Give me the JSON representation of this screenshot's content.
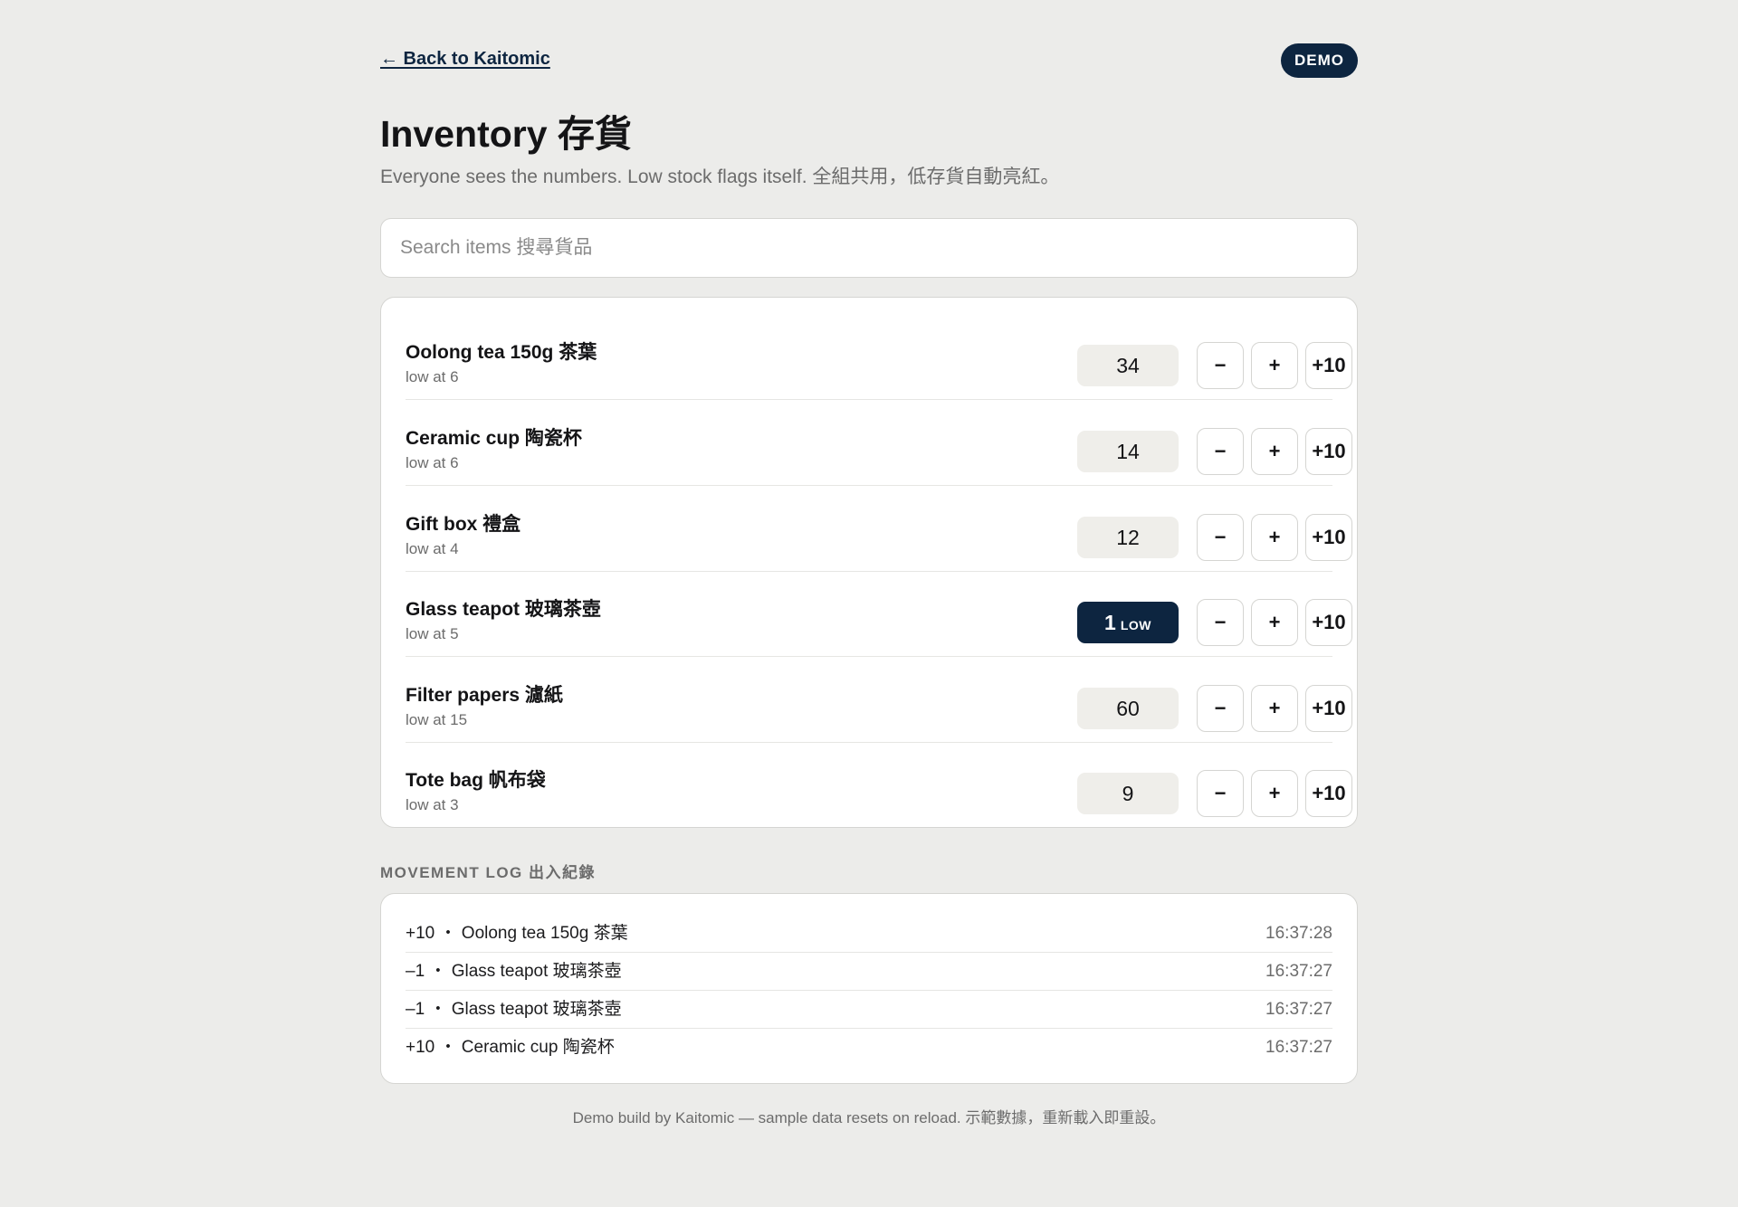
{
  "header": {
    "back_link": "← Back to Kaitomic",
    "badge": "DEMO"
  },
  "page": {
    "title": "Inventory 存貨",
    "subtitle": "Everyone sees the numbers. Low stock flags itself. 全組共用，低存貨自動亮紅。"
  },
  "search": {
    "placeholder": "Search items 搜尋貨品",
    "value": ""
  },
  "buttons": {
    "minus": "−",
    "plus": "+",
    "plus10": "+10"
  },
  "items": [
    {
      "name": "Oolong tea 150g 茶葉",
      "threshold": "low at 6",
      "qty": "34",
      "low_label": ""
    },
    {
      "name": "Ceramic cup 陶瓷杯",
      "threshold": "low at 6",
      "qty": "14",
      "low_label": ""
    },
    {
      "name": "Gift box 禮盒",
      "threshold": "low at 4",
      "qty": "12",
      "low_label": ""
    },
    {
      "name": "Glass teapot 玻璃茶壺",
      "threshold": "low at 5",
      "qty": "1",
      "low_label": "LOW"
    },
    {
      "name": "Filter papers 濾紙",
      "threshold": "low at 15",
      "qty": "60",
      "low_label": ""
    },
    {
      "name": "Tote bag 帆布袋",
      "threshold": "low at 3",
      "qty": "9",
      "low_label": ""
    }
  ],
  "movement_log": {
    "heading": "MOVEMENT LOG 出入紀錄",
    "entries": [
      {
        "text": "+10 ・ Oolong tea 150g 茶葉",
        "time": "16:37:28"
      },
      {
        "text": "–1 ・ Glass teapot 玻璃茶壺",
        "time": "16:37:27"
      },
      {
        "text": "–1 ・ Glass teapot 玻璃茶壺",
        "time": "16:37:27"
      },
      {
        "text": "+10 ・ Ceramic cup 陶瓷杯",
        "time": "16:37:27"
      }
    ]
  },
  "footer": {
    "text": "Demo build by Kaitomic — sample data resets on reload. 示範數據，重新載入即重設。"
  },
  "colors": {
    "background": "#ececea",
    "accent_navy": "#0d2540",
    "card": "#ffffff",
    "qty_chip": "#efeeea",
    "muted_text": "#6c6c6c"
  }
}
